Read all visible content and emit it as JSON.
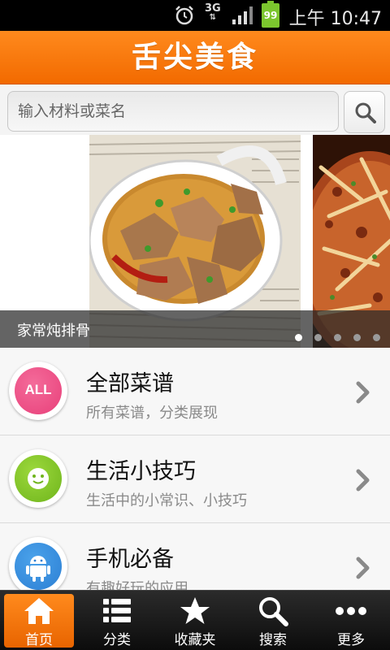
{
  "status_bar": {
    "network": "3G",
    "battery": "99",
    "time": "上午 10:47",
    "icons": [
      "alarm-icon",
      "signal-icon",
      "battery-icon"
    ]
  },
  "header": {
    "title": "舌尖美食"
  },
  "search": {
    "placeholder": "输入材料或菜名",
    "button_icon": "search-icon"
  },
  "banner": {
    "caption": "家常炖排骨",
    "slide_count": 5,
    "active_index": 0
  },
  "menu": {
    "items": [
      {
        "icon_text": "ALL",
        "title": "全部菜谱",
        "subtitle": "所有菜谱，分类展现",
        "icon": "all-icon",
        "color": "#e8407a"
      },
      {
        "icon_text": "",
        "title": "生活小技巧",
        "subtitle": "生活中的小常识、小技巧",
        "icon": "smiley-icon",
        "color": "#7cc225"
      },
      {
        "icon_text": "",
        "title": "手机必备",
        "subtitle": "有趣好玩的应用",
        "icon": "android-icon",
        "color": "#2c7fd4"
      }
    ]
  },
  "bottom_nav": {
    "items": [
      {
        "label": "首页",
        "icon": "home-icon",
        "active": true
      },
      {
        "label": "分类",
        "icon": "list-icon",
        "active": false
      },
      {
        "label": "收藏夹",
        "icon": "star-icon",
        "active": false
      },
      {
        "label": "搜索",
        "icon": "search-icon",
        "active": false
      },
      {
        "label": "更多",
        "icon": "more-icon",
        "active": false
      }
    ]
  },
  "colors": {
    "brand_orange": "#f57700",
    "nav_background": "#1a1a1a"
  }
}
